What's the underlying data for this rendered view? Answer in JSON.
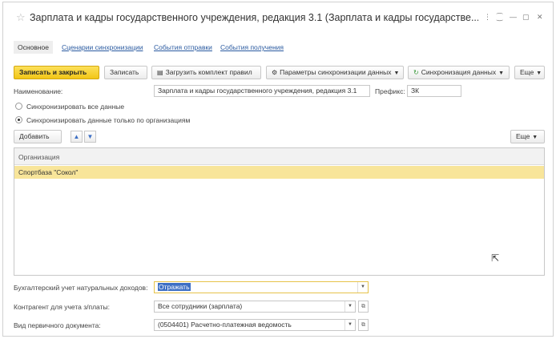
{
  "window": {
    "title": "Зарплата и кадры государственного учреждения, редакция 3.1 (Зарплата и кадры государстве...",
    "controls": [
      "⋮",
      "⁐",
      "—",
      "▢",
      "✕"
    ]
  },
  "tabs": [
    {
      "label": "Основное"
    },
    {
      "label": "Сценарии синхронизации"
    },
    {
      "label": "События отправки"
    },
    {
      "label": "События получения"
    }
  ],
  "toolbar": {
    "save_close": "Записать и закрыть",
    "save": "Записать",
    "load_rules": "Загрузить комплект правил",
    "sync_params": "Параметры синхронизации данных",
    "sync_data": "Синхронизация данных",
    "more": "Еще"
  },
  "name_field": {
    "label": "Наименование:",
    "value": "Зарплата и кадры государственного учреждения, редакция 3.1"
  },
  "prefix_field": {
    "label": "Префикс:",
    "value": "ЗК"
  },
  "radios": [
    {
      "label": "Синхронизировать все данные",
      "checked": false
    },
    {
      "label": "Синхронизировать данные только по организациям",
      "checked": true
    }
  ],
  "org_toolbar": {
    "add": "Добавить",
    "more": "Еще"
  },
  "table": {
    "header": "Организация",
    "rows": [
      "Спортбаза \"Сокол\""
    ]
  },
  "bottom_fields": [
    {
      "label": "Бухгалтерский учет натуральных доходов:",
      "value": "Отражать"
    },
    {
      "label": "Контрагент для учета з/платы:",
      "value": "Все сотрудники (зарплата)"
    },
    {
      "label": "Вид первичного документа:",
      "value": "(0504401) Расчетно-платежная ведомость"
    }
  ],
  "colors": {
    "primary_button": "#f2c617",
    "selected_row": "#f8e59a",
    "link": "#2a5aa0",
    "selection": "#3d6fc4"
  }
}
